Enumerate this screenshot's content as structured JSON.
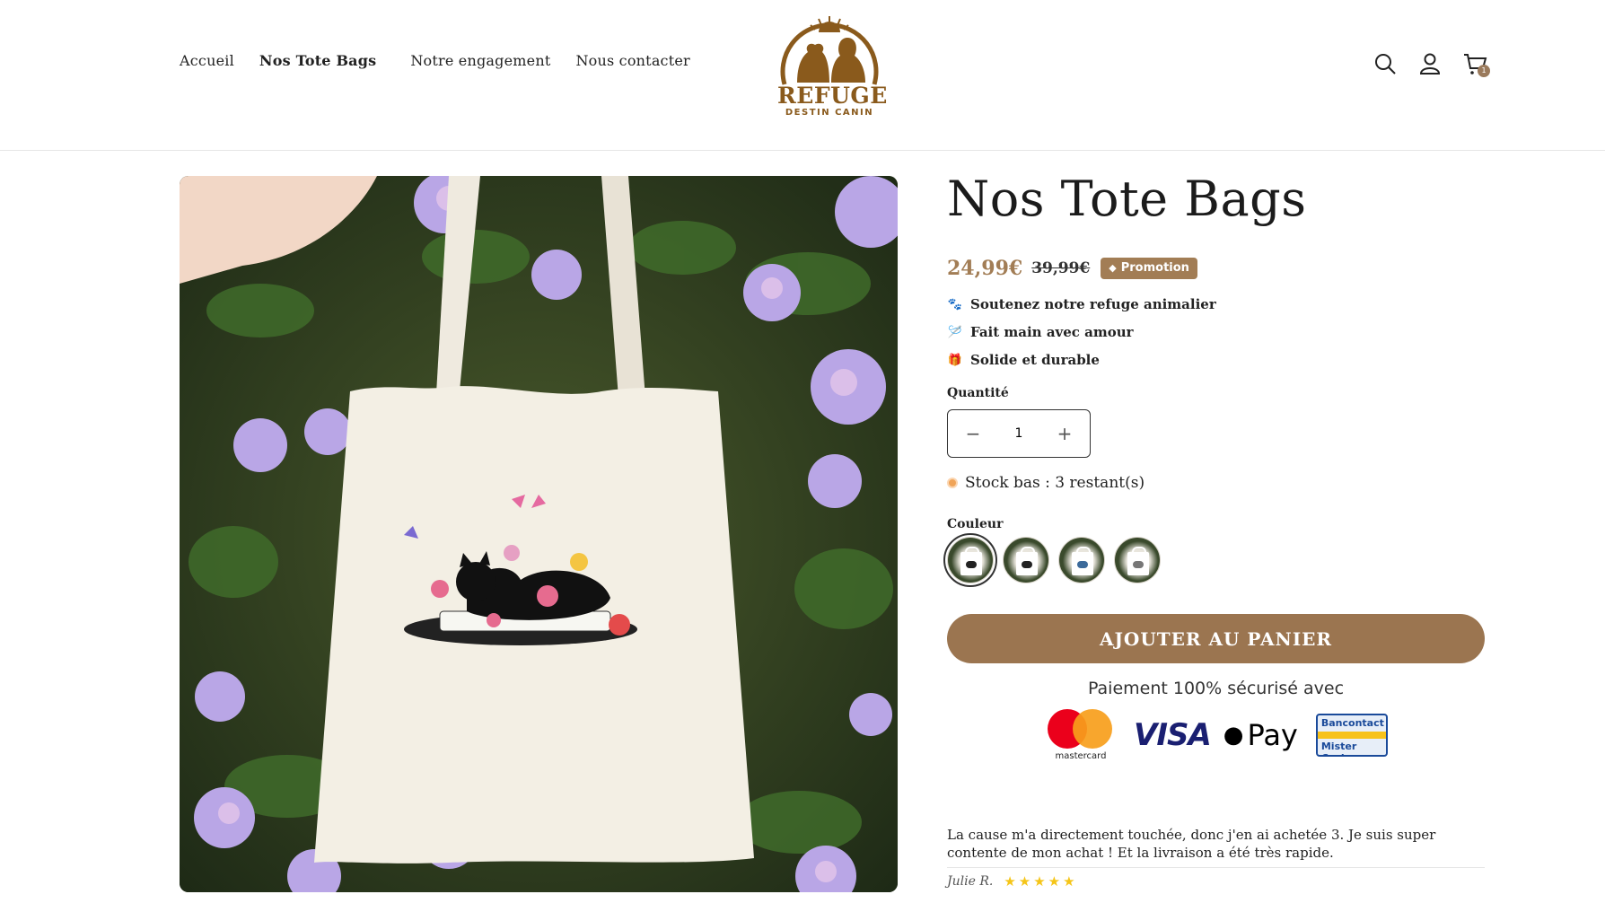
{
  "header": {
    "nav": [
      {
        "label": "Accueil"
      },
      {
        "label": "Nos Tote Bags"
      },
      {
        "label": "Notre engagement"
      },
      {
        "label": "Nous contacter"
      }
    ],
    "logo": {
      "title": "REFUGE",
      "subtitle": "DESTIN CANIN"
    },
    "cart_count": "1"
  },
  "product": {
    "title": "Nos Tote Bags",
    "price": "24,99€",
    "old_price": "39,99€",
    "badge": "Promotion",
    "features": [
      {
        "icon": "paw-icon",
        "glyph": "🐾",
        "label": "Soutenez notre refuge animalier"
      },
      {
        "icon": "needle-icon",
        "glyph": "🪡",
        "label": "Fait main avec amour"
      },
      {
        "icon": "gift-icon",
        "glyph": "🎁",
        "label": "Solide et durable"
      }
    ],
    "quantity_label": "Quantité",
    "quantity": "1",
    "stock_text": "Stock bas : 3 restant(s)",
    "color_label": "Couleur",
    "add_to_cart": "AJOUTER AU PANIER",
    "secure_payment": "Paiement 100% sécurisé avec",
    "payment": {
      "mastercard": "mastercard",
      "visa": "VISA",
      "applepay": "Pay",
      "bancontact_top": "Bancontact",
      "bancontact_bottom": "Mister Cash"
    }
  },
  "review": {
    "text": "La cause m'a directement touchée, donc j'en ai achetée 3. Je suis super contente de mon achat ! Et la livraison a été très rapide.",
    "author": "Julie R.",
    "stars": "★★★★★",
    "rating": 5
  },
  "colors": {
    "accent": "#9b7550",
    "price": "#a27d55",
    "logo": "#8a5a1c"
  }
}
